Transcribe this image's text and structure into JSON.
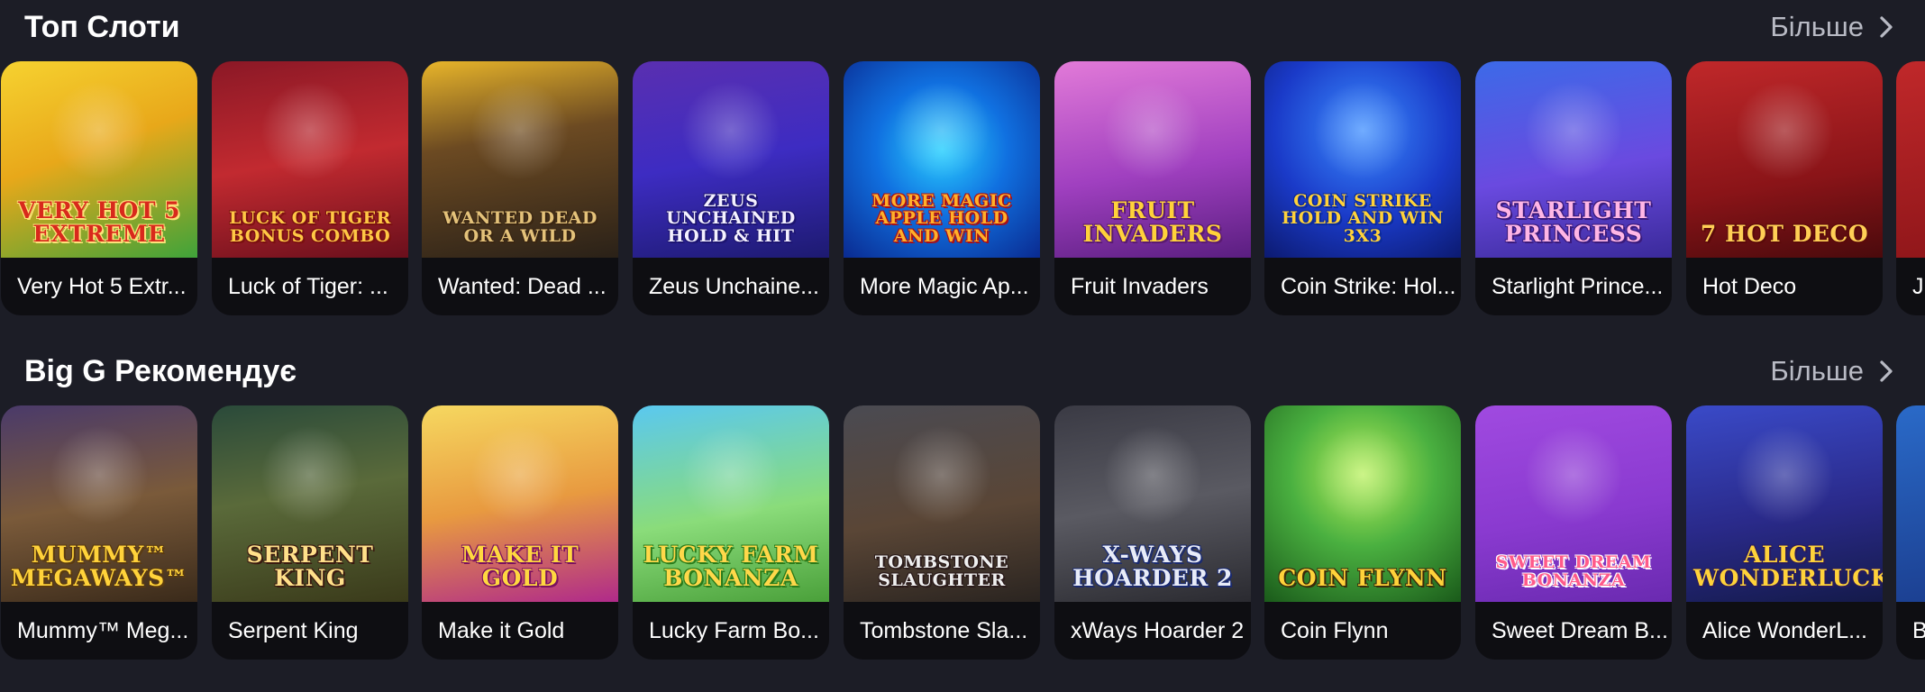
{
  "sections": [
    {
      "title": "Топ Слоти",
      "more_label": "Більше",
      "games": [
        {
          "caption": "Very Hot 5 Extr...",
          "logo": "VERY HOT 5 Extreme",
          "bg": "linear-gradient(160deg,#f6d230 0%,#e8a81a 45%,#3fa33a 100%)",
          "logo_color": "#d8291c",
          "stroke": "#ffe27a"
        },
        {
          "caption": "Luck of Tiger: ...",
          "logo": "LUCK of TIGER BONUS COMBO",
          "bg": "linear-gradient(170deg,#8b1826 0%,#c22a30 50%,#6a0f1c 100%)",
          "logo_color": "#ffc845",
          "stroke": "#7a1010"
        },
        {
          "caption": "Wanted: Dead ...",
          "logo": "WANTED DEAD OR A WILD",
          "bg": "linear-gradient(170deg,#e8b52a 0%,#6c4a22 40%,#2a2118 100%)",
          "logo_color": "#e4c27a",
          "stroke": "#3a2612"
        },
        {
          "caption": "Zeus Unchaine...",
          "logo": "ZEUS UNCHAINED HOLD & HIT",
          "bg": "linear-gradient(170deg,#5a2fb0 0%,#3d2cc2 50%,#1d1a70 100%)",
          "logo_color": "#f4f1ff",
          "stroke": "#1d1570"
        },
        {
          "caption": "More Magic Ap...",
          "logo": "More MAGIC APPLE HOLD AND WIN",
          "bg": "radial-gradient(circle at 50% 45%,#2ad0ff 0%,#1070e0 45%,#0a2a90 100%)",
          "logo_color": "#ffb02a",
          "stroke": "#a81018"
        },
        {
          "caption": "Fruit Invaders",
          "logo": "FRUIT INVADERS",
          "bg": "linear-gradient(170deg,#e27ad8 0%,#a040c0 55%,#5a1e80 100%)",
          "logo_color": "#ffd23a",
          "stroke": "#5a1a70"
        },
        {
          "caption": "Coin Strike: Hol...",
          "logo": "COIN STRIKE HOLD AND WIN 3x3",
          "bg": "radial-gradient(circle at 50% 35%,#3a8cff 0%,#1a3ac8 55%,#0c1a70 100%)",
          "logo_color": "#ffd23a",
          "stroke": "#0c2a9a"
        },
        {
          "caption": "Starlight Prince...",
          "logo": "Starlight Princess",
          "bg": "linear-gradient(170deg,#3c6ae8 0%,#6a4ae0 55%,#3a2a9a 100%)",
          "logo_color": "#ffb6e6",
          "stroke": "#3a1a7a"
        },
        {
          "caption": "Hot Deco",
          "logo": "7 HOT DECO",
          "bg": "linear-gradient(170deg,#c0282a 0%,#8a1418 60%,#4a0a0c 100%)",
          "logo_color": "#ffcf55",
          "stroke": "#5a0a0a"
        },
        {
          "caption": "J...",
          "logo": "",
          "bg": "linear-gradient(170deg,#c0282a 0%,#8a1418 100%)",
          "logo_color": "#ffcf55",
          "stroke": "#5a0a0a"
        }
      ]
    },
    {
      "title": "Big G Рекомендує",
      "more_label": "Більше",
      "games": [
        {
          "caption": "Mummy™ Meg...",
          "logo": "MUMMY™ MEGAWAYS™",
          "bg": "linear-gradient(170deg,#4a3a6a 0%,#7a5a3a 50%,#3a2a1a 100%)",
          "logo_color": "#ffd23a",
          "stroke": "#5a3a10"
        },
        {
          "caption": "Serpent King",
          "logo": "SERPENT KING",
          "bg": "linear-gradient(170deg,#2a4a3a 0%,#5a6a3a 45%,#3a3a1a 100%)",
          "logo_color": "#ffe08a",
          "stroke": "#3a1a10"
        },
        {
          "caption": "Make it Gold",
          "logo": "MAKE IT GOLD",
          "bg": "linear-gradient(170deg,#f6d860 0%,#e89a40 50%,#b02a8a 100%)",
          "logo_color": "#ffd840",
          "stroke": "#7a1060"
        },
        {
          "caption": "Lucky Farm Bo...",
          "logo": "LUCKY FARM BONANZA",
          "bg": "linear-gradient(170deg,#5ac8f0 0%,#8adc7a 55%,#4aa03a 100%)",
          "logo_color": "#ffd84a",
          "stroke": "#2a7a1a"
        },
        {
          "caption": "Tombstone Sla...",
          "logo": "TOMBSTONE SLAUGHTER",
          "bg": "linear-gradient(170deg,#4a4a52 0%,#5a4636 55%,#2a2420 100%)",
          "logo_color": "#f0f0f0",
          "stroke": "#2a1a1a"
        },
        {
          "caption": "xWays Hoarder 2",
          "logo": "X-WAYS HOARDER 2",
          "bg": "linear-gradient(170deg,#3a3a44 0%,#5a5a62 50%,#2a2a30 100%)",
          "logo_color": "#e8ecf8",
          "stroke": "#1a2a70"
        },
        {
          "caption": "Coin Flynn",
          "logo": "COIN FLYNN",
          "bg": "radial-gradient(circle at 50% 35%,#b8f05a 0%,#4ab040 45%,#1a5a1a 100%)",
          "logo_color": "#ffd23a",
          "stroke": "#3a2a0a"
        },
        {
          "caption": "Sweet Dream B...",
          "logo": "Sweet Dream Bonanza",
          "bg": "linear-gradient(170deg,#a04ae0 0%,#8a3ad0 55%,#6a2ab0 100%)",
          "logo_color": "#ff5a8a",
          "stroke": "#ffffff"
        },
        {
          "caption": "Alice WonderL...",
          "logo": "ALICE WONDERLUCK",
          "bg": "linear-gradient(170deg,#3a4ac8 0%,#2a2a8a 55%,#141a4a 100%)",
          "logo_color": "#ffd23a",
          "stroke": "#2a1a5a"
        },
        {
          "caption": "B...",
          "logo": "",
          "bg": "linear-gradient(170deg,#2a6ac8 0%,#1a3a8a 100%)",
          "logo_color": "#ffd23a",
          "stroke": "#1a1a5a"
        }
      ]
    }
  ],
  "icons": {
    "more": "chevron-right-icon"
  },
  "colors": {
    "background": "#1c1d26",
    "card": "#0e0e12",
    "muted": "#b8bac4"
  }
}
